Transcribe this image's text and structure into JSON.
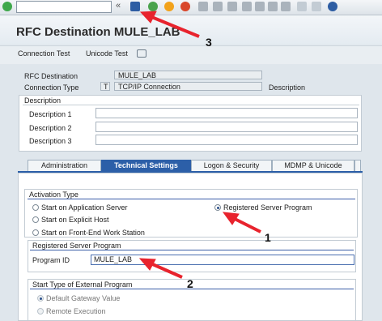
{
  "toolbar": {
    "command_placeholder": "",
    "collapse_glyph": "«",
    "icons": [
      "check-icon",
      "save-icon",
      "back-icon",
      "exit-icon",
      "cancel-icon",
      "print-icon",
      "find-icon",
      "find-next-icon",
      "first-page-icon",
      "prev-page-icon",
      "next-page-icon",
      "last-page-icon",
      "new-session-icon",
      "shortcut-icon",
      "help-icon"
    ]
  },
  "page_title": "RFC Destination MULE_LAB",
  "app_toolbar": {
    "connection_test": "Connection Test",
    "unicode_test": "Unicode Test"
  },
  "header": {
    "rfc_destination_label": "RFC Destination",
    "rfc_destination_value": "MULE_LAB",
    "connection_type_label": "Connection Type",
    "connection_type_code": "T",
    "connection_type_value": "TCP/IP Connection",
    "description_label": "Description"
  },
  "description_group": {
    "title": "Description",
    "fields": [
      {
        "label": "Description 1",
        "value": ""
      },
      {
        "label": "Description 2",
        "value": ""
      },
      {
        "label": "Description 3",
        "value": ""
      }
    ]
  },
  "tabs": [
    {
      "label": "Administration"
    },
    {
      "label": "Technical Settings"
    },
    {
      "label": "Logon & Security"
    },
    {
      "label": "MDMP & Unicode"
    }
  ],
  "activation": {
    "title": "Activation Type",
    "options": [
      {
        "label": "Start on Application Server",
        "selected": false
      },
      {
        "label": "Registered Server Program",
        "selected": true
      },
      {
        "label": "Start on Explicit Host",
        "selected": false
      },
      {
        "label": "Start on Front-End Work Station",
        "selected": false
      }
    ]
  },
  "registered": {
    "title": "Registered Server Program",
    "program_id_label": "Program ID",
    "program_id_value": "MULE_LAB"
  },
  "start_type": {
    "title": "Start Type of External Program",
    "options": [
      {
        "label": "Default Gateway Value",
        "selected": true
      },
      {
        "label": "Remote Execution",
        "selected": false
      }
    ]
  },
  "annotations": {
    "one": "1",
    "two": "2",
    "three": "3",
    "color": "#e8232d"
  },
  "colors": {
    "tab_active": "#2c5fa8",
    "section_line": "#3b5ea8"
  }
}
